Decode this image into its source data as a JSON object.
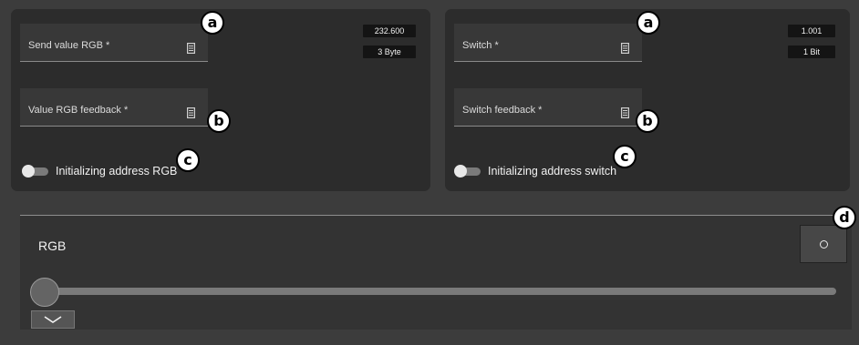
{
  "panels": {
    "left": {
      "send_label": "Send value RGB *",
      "feedback_label": "Value RGB feedback *",
      "toggle_label": "Initializing address RGB",
      "badge_dpt": "232.600",
      "badge_size": "3 Byte"
    },
    "right": {
      "send_label": "Switch *",
      "feedback_label": "Switch feedback *",
      "toggle_label": "Initializing address switch",
      "badge_dpt": "1.001",
      "badge_size": "1 Bit"
    }
  },
  "markers": {
    "a": "a",
    "b": "b",
    "c": "c",
    "d": "d"
  },
  "bottom": {
    "title": "RGB",
    "slider_value_fraction": 0.0
  },
  "icons": {
    "field_icon": "document-icon",
    "toggle_state": "off",
    "color_button_icon": "circle-icon",
    "expand_icon": "chevron-down-icon"
  },
  "colors": {
    "background": "#3c3c3c",
    "panel": "#2c2c2c",
    "field": "#383838",
    "badge": "#141414",
    "marker_fill": "#ffffff"
  }
}
